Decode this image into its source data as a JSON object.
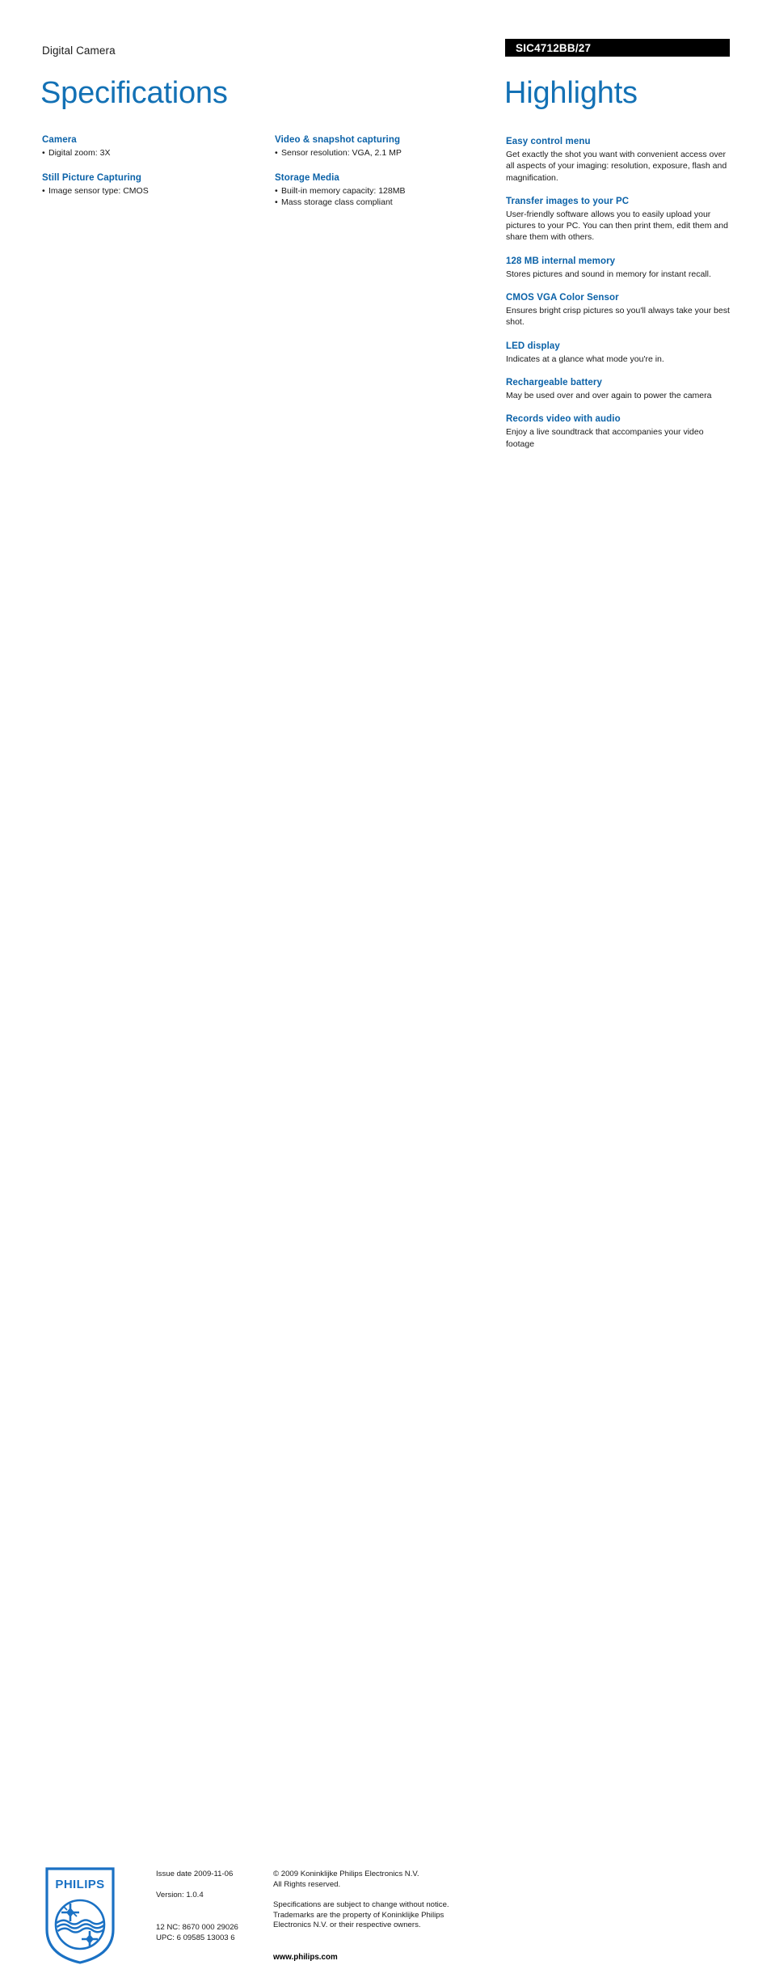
{
  "header": {
    "product_category": "Digital Camera",
    "model_code": "SIC4712BB/27"
  },
  "titles": {
    "specifications": "Specifications",
    "highlights": "Highlights"
  },
  "colors": {
    "title_blue": "#1371b5",
    "heading_blue": "#0b62a8",
    "model_bar_bg": "#000000",
    "logo_blue": "#1a71c4"
  },
  "specifications": {
    "column_1": [
      {
        "heading": "Camera",
        "items": [
          "Digital zoom: 3X"
        ]
      },
      {
        "heading": "Still Picture Capturing",
        "items": [
          "Image sensor type: CMOS"
        ]
      }
    ],
    "column_2": [
      {
        "heading": "Video & snapshot capturing",
        "items": [
          "Sensor resolution: VGA, 2.1 MP"
        ]
      },
      {
        "heading": "Storage Media",
        "items": [
          "Built-in memory capacity: 128MB",
          "Mass storage class compliant"
        ]
      }
    ],
    "bullet": "•"
  },
  "highlights": [
    {
      "title": "Easy control menu",
      "body": "Get exactly the shot you want with convenient access over all aspects of your imaging: resolution, exposure, flash and magnification."
    },
    {
      "title": "Transfer images to your PC",
      "body": "User-friendly software allows you to easily upload your pictures to your PC. You can then print them, edit them and share them with others."
    },
    {
      "title": "128 MB internal memory",
      "body": "Stores pictures and sound in memory for instant recall."
    },
    {
      "title": "CMOS VGA Color Sensor",
      "body": "Ensures bright crisp pictures so you'll always take your best shot."
    },
    {
      "title": "LED display",
      "body": "Indicates at a glance what mode you're in."
    },
    {
      "title": "Rechargeable battery",
      "body": "May be used over and over again to power the camera"
    },
    {
      "title": "Records video with audio",
      "body": "Enjoy a live soundtrack that accompanies your video footage"
    }
  ],
  "footer": {
    "logo_wordmark": "PHILIPS",
    "issue_date": "Issue date 2009-11-06",
    "version": "Version: 1.0.4",
    "twelve_nc": "12 NC: 8670 000 29026",
    "upc": "UPC: 6 09585 13003 6",
    "copyright_line_1": "© 2009 Koninklijke Philips Electronics N.V.",
    "copyright_line_2": "All Rights reserved.",
    "disclaimer_line_1": "Specifications are subject to change without notice.",
    "disclaimer_line_2": "Trademarks are the property of Koninklijke Philips",
    "disclaimer_line_3": "Electronics N.V. or their respective owners.",
    "website": "www.philips.com"
  }
}
